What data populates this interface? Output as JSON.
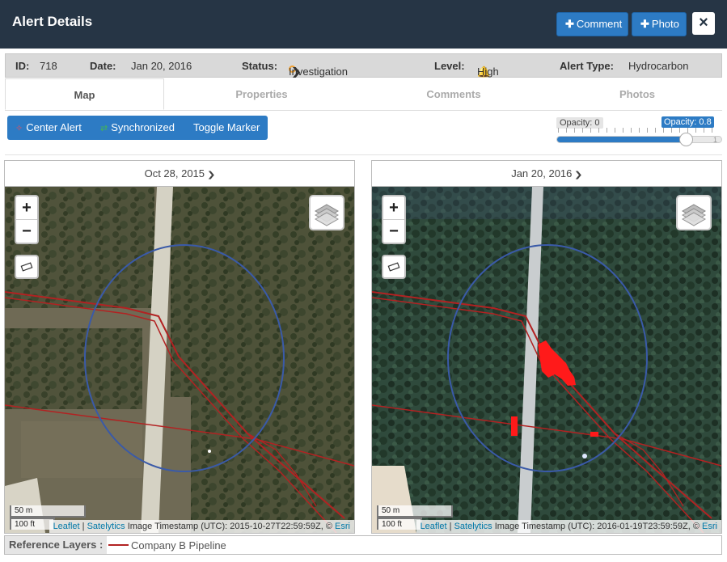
{
  "header": {
    "title": "Alert Details",
    "comment_label": "Comment",
    "photo_label": "Photo",
    "close_icon": "×"
  },
  "info": {
    "id_label": "ID:",
    "id_value": "718",
    "date_label": "Date:",
    "date_value": "Jan 20, 2016",
    "status_label": "Status:",
    "status_value": "Investigation",
    "level_label": "Level:",
    "level_value": "High",
    "type_label": "Alert Type:",
    "type_value": "Hydrocarbon"
  },
  "tabs": [
    {
      "label": "Map"
    },
    {
      "label": "Properties"
    },
    {
      "label": "Comments"
    },
    {
      "label": "Photos"
    }
  ],
  "toolbar": {
    "center_label": "Center Alert",
    "sync_label": "Synchronized",
    "toggle_label": "Toggle Marker"
  },
  "opacity": {
    "min_label": "Opacity: 0",
    "current_label": "Opacity: 0.8",
    "max_label": "1",
    "value": 0.8
  },
  "maps": [
    {
      "date": "Oct 28, 2015",
      "zoom_in": "+",
      "zoom_out": "−",
      "scale_m": "50 m",
      "scale_ft": "100 ft",
      "attrib_leaflet": "Leaflet",
      "attrib_sep": " | ",
      "attrib_satelytics": "Satelytics",
      "attrib_text": " Image Timestamp (UTC): 2015-10-27T22:59:59Z, © ",
      "attrib_esri": "Esri"
    },
    {
      "date": "Jan 20, 2016",
      "zoom_in": "+",
      "zoom_out": "−",
      "scale_m": "50 m",
      "scale_ft": "100 ft",
      "attrib_leaflet": "Leaflet",
      "attrib_sep": " | ",
      "attrib_satelytics": "Satelytics",
      "attrib_text": " Image Timestamp (UTC): 2016-01-19T23:59:59Z, © ",
      "attrib_esri": "Esri"
    }
  ],
  "reference": {
    "label": "Reference Layers :",
    "layer_name": "Company B Pipeline"
  },
  "colors": {
    "header_bg": "#263545",
    "accent": "#2d7bc4",
    "pipeline": "#b22222",
    "alert_circle": "#3a5aa8",
    "spill": "#ff1a1a",
    "status_icon": "#f0a030"
  },
  "icons": {
    "center": "crosshair-icon",
    "sync": "sync-icon",
    "status": "circle-outline-icon",
    "level": "bell-icon",
    "layers": "layers-icon",
    "measure": "ruler-icon"
  }
}
